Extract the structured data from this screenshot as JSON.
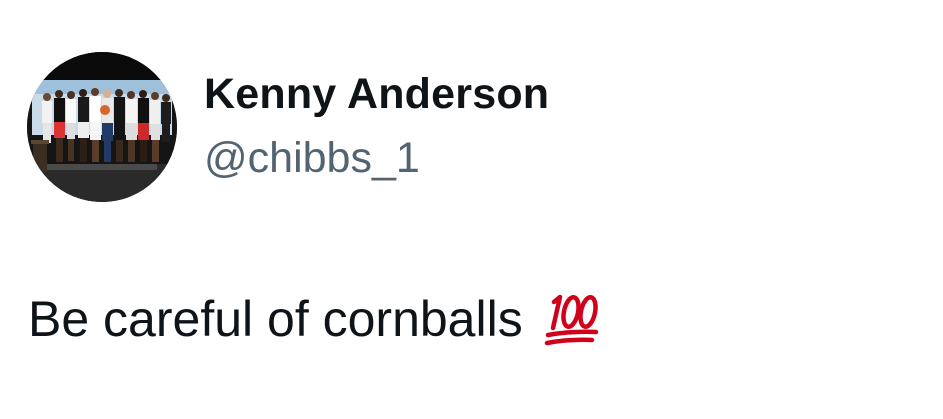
{
  "tweet": {
    "author": {
      "display_name": "Kenny Anderson",
      "handle": "@chibbs_1"
    },
    "text": "Be careful of cornballs",
    "emoji": "hundred-points-icon",
    "colors": {
      "name": "#0f1419",
      "handle": "#536471",
      "emoji": "#d0021b"
    }
  }
}
